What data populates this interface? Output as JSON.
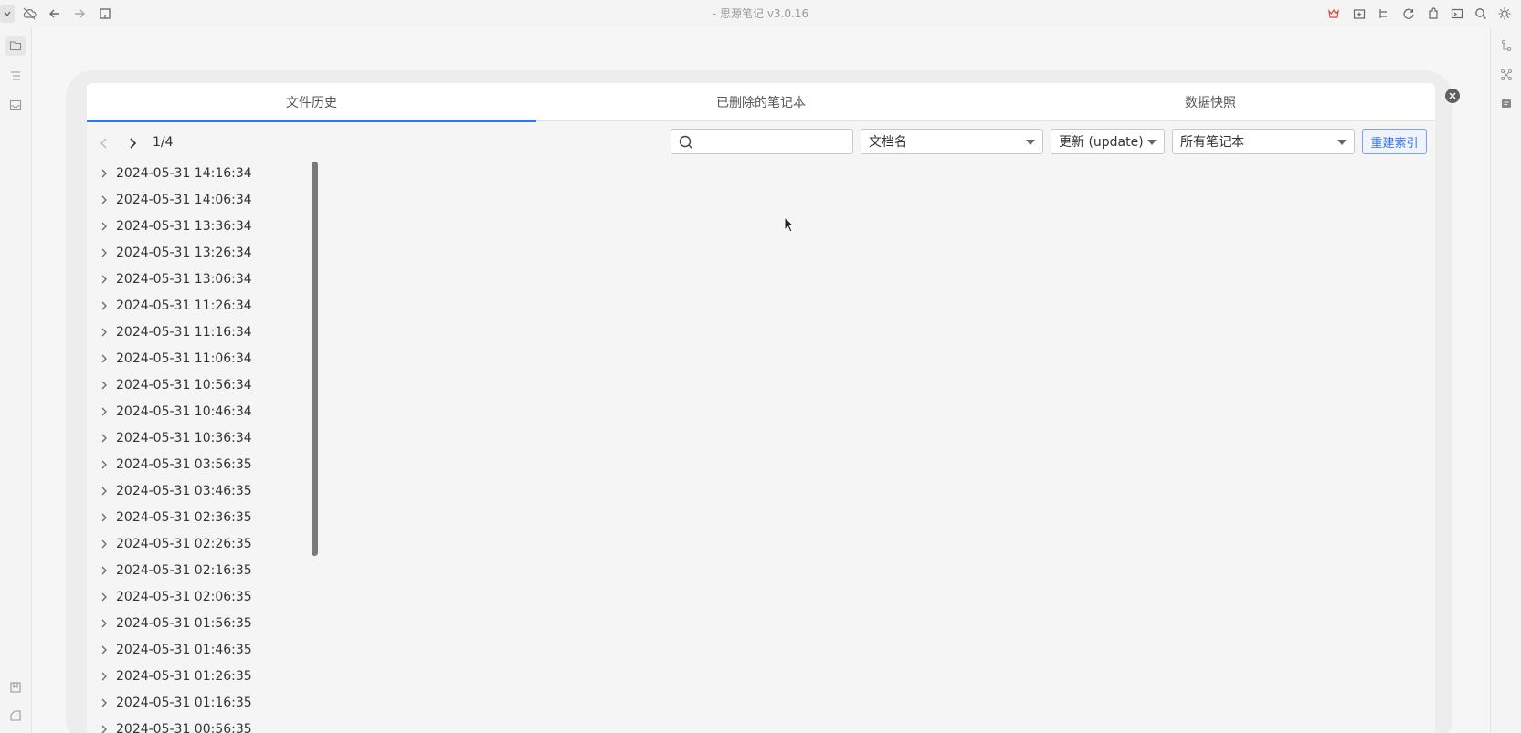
{
  "app": {
    "window_title": "- 思源笔记 v3.0.16"
  },
  "topbar": {
    "left_icons": [
      "workspace-menu-icon",
      "cloud-off-icon",
      "back-arrow-icon",
      "forward-arrow-icon",
      "bookmark-icon"
    ],
    "right_icons": [
      "vip-crown-icon",
      "folder-plus-icon",
      "tree-icon",
      "sync-icon",
      "plugin-icon",
      "terminal-icon",
      "search-icon",
      "theme-sun-icon"
    ]
  },
  "left_dock": {
    "icons": [
      "file-tree-icon",
      "outline-icon",
      "inbox-icon",
      "bookmark-dock-icon",
      "tag-dock-icon"
    ]
  },
  "right_dock": {
    "icons": [
      "git-branch-icon",
      "graph-icon",
      "backlink-icon"
    ]
  },
  "dialog": {
    "tabs": [
      {
        "label": "文件历史",
        "active": true
      },
      {
        "label": "已删除的笔记本",
        "active": false
      },
      {
        "label": "数据快照",
        "active": false
      }
    ],
    "pager": {
      "current": "1/4"
    },
    "search": {
      "placeholder": "",
      "value": ""
    },
    "filters": {
      "type": "文档名",
      "op": "更新 (update)",
      "notebook": "所有笔记本"
    },
    "rebuild_label": "重建索引",
    "accent_color": "#3573f0",
    "history_items": [
      "2024-05-31 14:16:34",
      "2024-05-31 14:06:34",
      "2024-05-31 13:36:34",
      "2024-05-31 13:26:34",
      "2024-05-31 13:06:34",
      "2024-05-31 11:26:34",
      "2024-05-31 11:16:34",
      "2024-05-31 11:06:34",
      "2024-05-31 10:56:34",
      "2024-05-31 10:46:34",
      "2024-05-31 10:36:34",
      "2024-05-31 03:56:35",
      "2024-05-31 03:46:35",
      "2024-05-31 02:36:35",
      "2024-05-31 02:26:35",
      "2024-05-31 02:16:35",
      "2024-05-31 02:06:35",
      "2024-05-31 01:56:35",
      "2024-05-31 01:46:35",
      "2024-05-31 01:26:35",
      "2024-05-31 01:16:35",
      "2024-05-31 00:56:35"
    ]
  }
}
